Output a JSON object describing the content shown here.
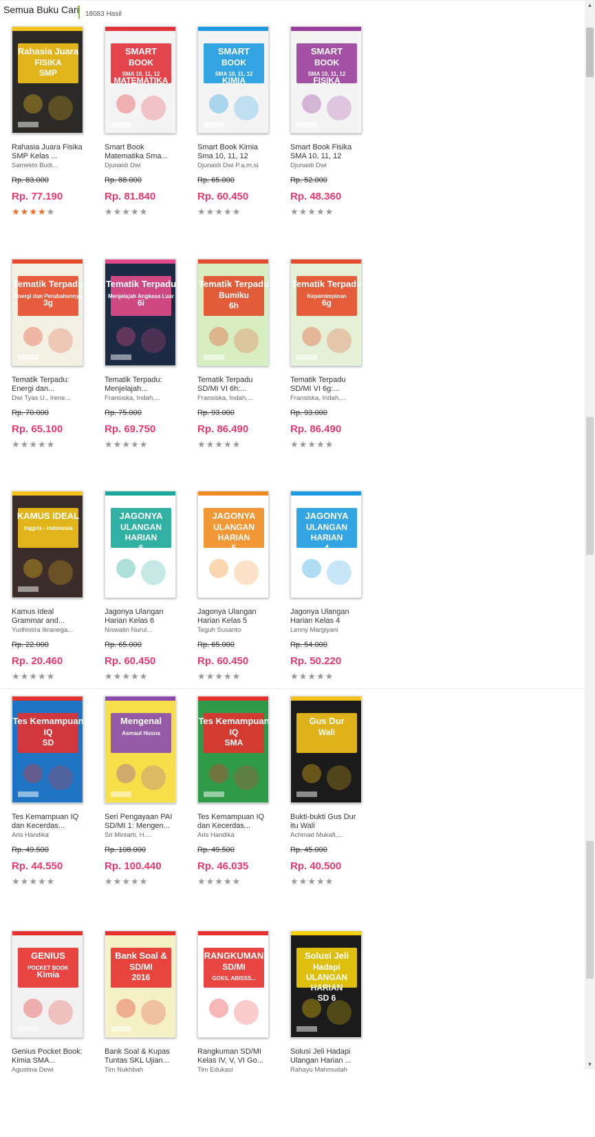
{
  "header": {
    "title": "Semua Buku Cari",
    "count": "18083 Hasil"
  },
  "books": [
    {
      "title": "Rahasia Juara Fisika SMP Kelas ...",
      "author": "Samekto Budi...",
      "old_price": "Rp. 83.000",
      "price": "Rp. 77.190",
      "rating": 4,
      "cover": {
        "bg": "#2b2a28",
        "accent": "#f5c31b",
        "lines": [
          "Rahasia Juara",
          "FISIKA",
          "SMP"
        ]
      }
    },
    {
      "title": "Smart Book Matematika Sma...",
      "author": "Djunaidi Dwi",
      "old_price": "Rp. 88.000",
      "price": "Rp. 81.840",
      "rating": 0,
      "cover": {
        "bg": "#f4f4f4",
        "accent": "#e2323a",
        "lines": [
          "SMART",
          "BOOK",
          "SMA 10, 11, 12",
          "MATEMATIKA"
        ]
      }
    },
    {
      "title": "Smart Book Kimia Sma 10, 11, 12",
      "author": "Djunaidi Dwi P.a.m.si",
      "old_price": "Rp. 65.000",
      "price": "Rp. 60.450",
      "rating": 0,
      "cover": {
        "bg": "#f4f4f4",
        "accent": "#1e9be0",
        "lines": [
          "SMART",
          "BOOK",
          "SMA 10, 11, 12",
          "KIMIA"
        ]
      }
    },
    {
      "title": "Smart Book Fisika SMA 10, 11, 12",
      "author": "Djunaidi Dwi",
      "old_price": "Rp. 52.000",
      "price": "Rp. 48.360",
      "rating": 0,
      "cover": {
        "bg": "#f4f4f4",
        "accent": "#9a3e9c",
        "lines": [
          "SMART",
          "BOOK",
          "SMA 10, 11, 12",
          "FISIKA"
        ]
      }
    },
    {
      "title": "Tematik Terpadu: Energi dan...",
      "author": "Dwi Tyas U., Irene...",
      "old_price": "Rp. 70.000",
      "price": "Rp. 65.100",
      "rating": 0,
      "cover": {
        "bg": "#f3f0e4",
        "accent": "#e44b2a",
        "lines": [
          "Tematik Terpadu",
          "Energi dan Perubahannya",
          "3g"
        ]
      }
    },
    {
      "title": "Tematik Terpadu: Menjelajah...",
      "author": "Fransiska, Indah,...",
      "old_price": "Rp. 75.000",
      "price": "Rp. 69.750",
      "rating": 0,
      "cover": {
        "bg": "#1d2a44",
        "accent": "#e44b8a",
        "lines": [
          "Tematik Terpadu",
          "Menjelajah Angkasa Luar",
          "6i"
        ]
      }
    },
    {
      "title": "Tematik Terpadu SD/MI VI 6h:...",
      "author": "Fransiska, Indah,...",
      "old_price": "Rp. 93.000",
      "price": "Rp. 86.490",
      "rating": 0,
      "cover": {
        "bg": "#d8eec0",
        "accent": "#e44b2a",
        "lines": [
          "Tematik Terpadu",
          "Bumiku",
          "6h"
        ]
      }
    },
    {
      "title": "Tematik Terpadu SD/MI VI 6g:...",
      "author": "Fransiska, Indah,...",
      "old_price": "Rp. 93.000",
      "price": "Rp. 86.490",
      "rating": 0,
      "cover": {
        "bg": "#e5f1d6",
        "accent": "#e44b2a",
        "lines": [
          "Tematik Terpadu",
          "Kepemimpinan",
          "6g"
        ]
      }
    },
    {
      "title": "Kamus Ideal Grammar and...",
      "author": "Yudhistira Ikranega...",
      "old_price": "Rp. 22.000",
      "price": "Rp. 20.460",
      "rating": 0,
      "cover": {
        "bg": "#3a2d2a",
        "accent": "#f5c31b",
        "lines": [
          "KAMUS IDEAL",
          "Inggris - Indonesia"
        ]
      }
    },
    {
      "title": "Jagonya Ulangan Harian Kelas 6",
      "author": "Niswatin Nurul...",
      "old_price": "Rp. 65.000",
      "price": "Rp. 60.450",
      "rating": 0,
      "cover": {
        "bg": "#ffffff",
        "accent": "#1ba89a",
        "lines": [
          "JAGONYA",
          "ULANGAN",
          "HARIAN",
          "6"
        ]
      }
    },
    {
      "title": "Jagonya Ulangan Harian Kelas 5",
      "author": "Teguh Susanto",
      "old_price": "Rp. 65.000",
      "price": "Rp. 60.450",
      "rating": 0,
      "cover": {
        "bg": "#ffffff",
        "accent": "#f08c1f",
        "lines": [
          "JAGONYA",
          "ULANGAN",
          "HARIAN",
          "5"
        ]
      }
    },
    {
      "title": "Jagonya Ulangan Harian Kelas 4",
      "author": "Lenny Margiyani",
      "old_price": "Rp. 54.000",
      "price": "Rp. 50.220",
      "rating": 0,
      "cover": {
        "bg": "#ffffff",
        "accent": "#1e9be0",
        "lines": [
          "JAGONYA",
          "ULANGAN",
          "HARIAN",
          "4"
        ]
      }
    },
    {
      "title": "Tes Kemampuan IQ dan Kecerdas...",
      "author": "Aris Handika",
      "old_price": "Rp. 49.500",
      "price": "Rp. 44.550",
      "rating": 0,
      "cover": {
        "bg": "#1f74c4",
        "accent": "#e6312f",
        "lines": [
          "Tes Kemampuan",
          "IQ",
          "SD"
        ]
      }
    },
    {
      "title": "Seri Pengayaan PAI SD/MI 1: Mengen...",
      "author": "Sri Mintarti, H....",
      "old_price": "Rp. 108.000",
      "price": "Rp. 100.440",
      "rating": 0,
      "cover": {
        "bg": "#f7df4a",
        "accent": "#8a4bb0",
        "lines": [
          "Mengenal",
          "Asmaul Husna"
        ]
      }
    },
    {
      "title": "Tes Kemampuan IQ dan Kecerdas...",
      "author": "Aris Handika",
      "old_price": "Rp. 49.500",
      "price": "Rp. 46.035",
      "rating": 0,
      "cover": {
        "bg": "#2f9a47",
        "accent": "#e6312f",
        "lines": [
          "Tes Kemampuan",
          "IQ",
          "SMA"
        ]
      }
    },
    {
      "title": "Bukti-bukti Gus Dur itu Wali",
      "author": "Achmad Mukafi,...",
      "old_price": "Rp. 45.000",
      "price": "Rp. 40.500",
      "rating": 0,
      "cover": {
        "bg": "#1b1b1b",
        "accent": "#f5c31b",
        "lines": [
          "Gus Dur",
          "Wali"
        ]
      }
    },
    {
      "title": "Genius Pocket Book: Kimia SMA...",
      "author": "Agustina Dewi",
      "old_price": "",
      "price": "",
      "rating": 0,
      "cover": {
        "bg": "#f1f1f1",
        "accent": "#e6312f",
        "lines": [
          "GENIUS",
          "POCKET BOOK",
          "Kimia"
        ]
      }
    },
    {
      "title": "Bank Soal & Kupas Tuntas SKL Ujian...",
      "author": "Tim Nukhbah",
      "old_price": "",
      "price": "",
      "rating": 0,
      "cover": {
        "bg": "#f5f0c5",
        "accent": "#e6312f",
        "lines": [
          "Bank Soal &",
          "SD/MI",
          "2016"
        ]
      }
    },
    {
      "title": "Rangkuman SD/MI Kelas IV, V, VI Go...",
      "author": "Tim Edukasi",
      "old_price": "",
      "price": "",
      "rating": 0,
      "cover": {
        "bg": "#ffffff",
        "accent": "#e6312f",
        "lines": [
          "RANGKUMAN",
          "SD/MI",
          "GOKIL ABISSS..."
        ]
      }
    },
    {
      "title": "Solusi Jeli Hadapi Ulangan Harian ...",
      "author": "Rahayu Mahmudah",
      "old_price": "",
      "price": "",
      "rating": 0,
      "cover": {
        "bg": "#1b1b1b",
        "accent": "#f5d10d",
        "lines": [
          "Solusi Jeli",
          "Hadapi",
          "ULANGAN",
          "HARIAN",
          "SD 6"
        ]
      }
    }
  ]
}
